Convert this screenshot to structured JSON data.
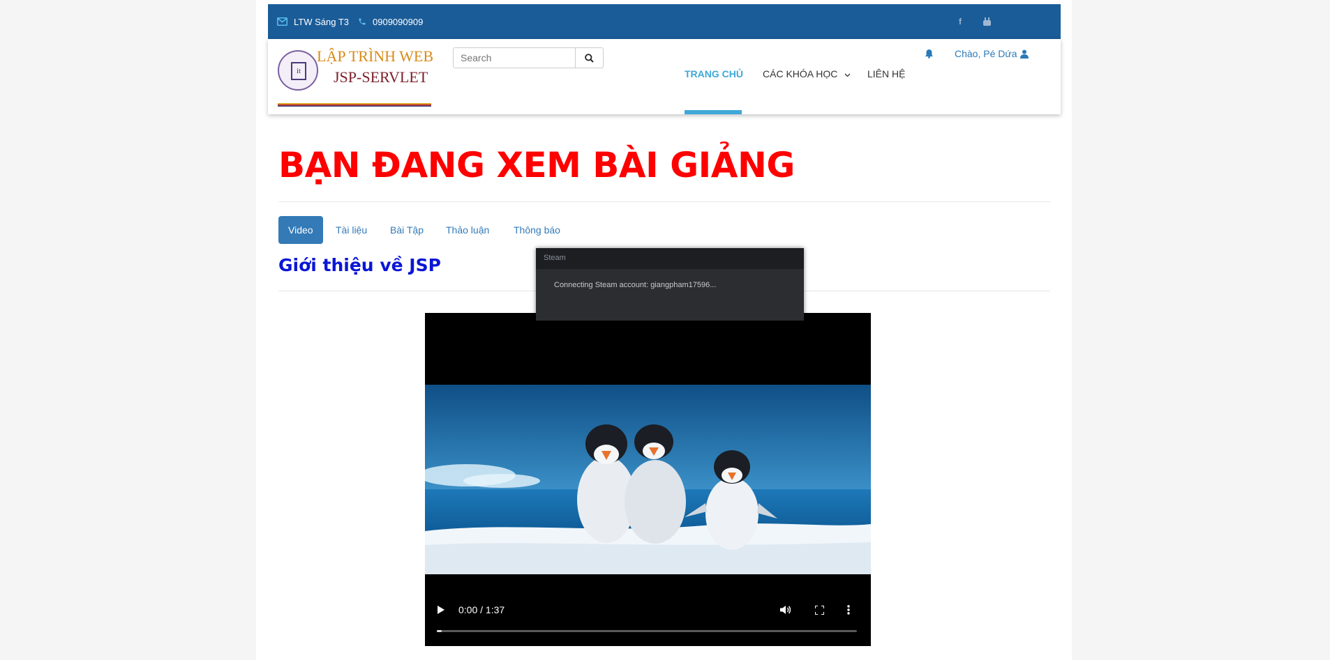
{
  "topbar": {
    "email_label": "LTW Sáng T3",
    "phone_label": "0909090909",
    "social_icons": [
      "facebook-icon",
      "youtube-icon"
    ],
    "background": "#1a5c98"
  },
  "logo": {
    "line1": "LẬP TRÌNH WEB",
    "line2": "JSP-SERVLET",
    "seal_text": "it"
  },
  "search": {
    "placeholder": "Search"
  },
  "nav": {
    "items": [
      {
        "label": "TRANG CHỦ",
        "active": true
      },
      {
        "label": "CÁC KHÓA HỌC",
        "has_dropdown": true
      },
      {
        "label": "LIÊN HỆ"
      }
    ],
    "active_color": "#3fa8d8"
  },
  "user": {
    "greeting": "Chào, Pé Dứa"
  },
  "page": {
    "title": "BẠN ĐANG XEM BÀI GIẢNG",
    "title_color": "#ff0000",
    "tabs": [
      {
        "label": "Video",
        "active": true
      },
      {
        "label": "Tài liệu"
      },
      {
        "label": "Bài Tập"
      },
      {
        "label": "Thảo luận"
      },
      {
        "label": "Thông báo"
      }
    ],
    "lesson_title": "Giới thiệu về JSP",
    "lesson_title_color": "#0b16d6"
  },
  "video": {
    "time": "0:00 / 1:37",
    "progress_fraction": 0.01,
    "controls": [
      "play-icon",
      "volume-icon",
      "fullscreen-icon",
      "more-options-icon"
    ]
  },
  "steam_popup": {
    "title": "Steam",
    "message": "Connecting Steam account: giangpham17596..."
  }
}
